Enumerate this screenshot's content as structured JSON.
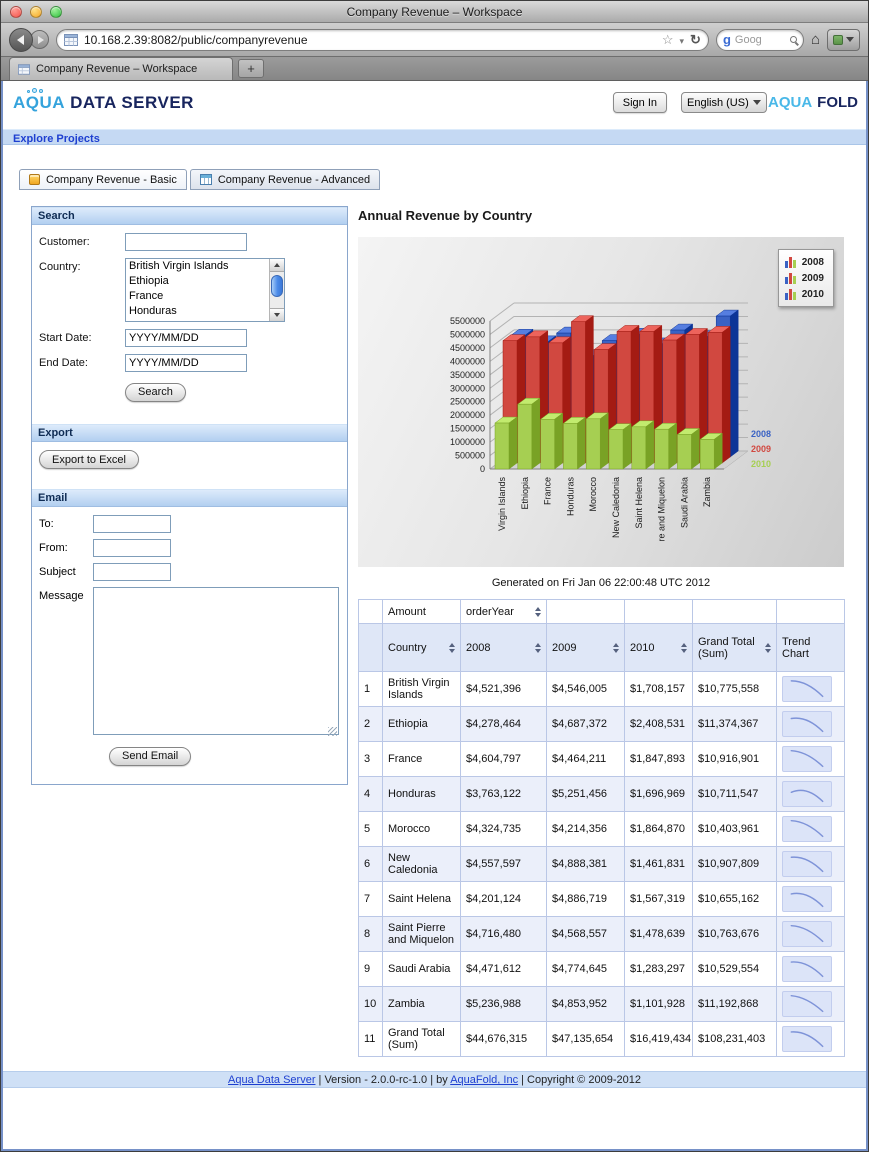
{
  "window": {
    "title": "Company Revenue – Workspace"
  },
  "browser": {
    "url": "10.168.2.39:8082/public/companyrevenue",
    "search_text": "Goog",
    "tab_title": "Company Revenue – Workspace",
    "new_tab_label": "+"
  },
  "header": {
    "logo_left": {
      "aqua": "AQUA",
      "rest": "DATA SERVER"
    },
    "sign_in_label": "Sign In",
    "language_value": "English (US)",
    "logo_right": {
      "aqua": "AQUA",
      "fold": "FOLD"
    }
  },
  "nav": {
    "explore_projects": "Explore Projects"
  },
  "app_tabs": [
    {
      "label": "Company Revenue - Basic"
    },
    {
      "label": "Company Revenue - Advanced"
    }
  ],
  "search_panel": {
    "title": "Search",
    "customer_label": "Customer:",
    "country_label": "Country:",
    "country_options": [
      "British Virgin Islands",
      "Ethiopia",
      "France",
      "Honduras"
    ],
    "start_date_label": "Start Date:",
    "end_date_label": "End Date:",
    "date_value": "YYYY/MM/DD",
    "search_button": "Search"
  },
  "export_panel": {
    "title": "Export",
    "button": "Export to Excel"
  },
  "email_panel": {
    "title": "Email",
    "to_label": "To:",
    "from_label": "From:",
    "subject_label": "Subject",
    "message_label": "Message",
    "send_button": "Send Email"
  },
  "report": {
    "title": "Annual Revenue by Country",
    "generated": "Generated on Fri Jan 06 22:00:48 UTC 2012"
  },
  "chart_data": {
    "type": "bar",
    "title": "Annual Revenue by Country",
    "categories": [
      "Virgin Islands",
      "Ethiopia",
      "France",
      "Honduras",
      "Morocco",
      "New Caledonia",
      "Saint Helena",
      "re and Miquelon",
      "Saudi Arabia",
      "Zambia"
    ],
    "series": [
      {
        "name": "2008",
        "color": "#3a62c4",
        "values": [
          4521396,
          4278464,
          4604797,
          3763122,
          4324735,
          4557597,
          4201124,
          4716480,
          4471612,
          5236988
        ]
      },
      {
        "name": "2009",
        "color": "#d14840",
        "values": [
          4546005,
          4687372,
          4464211,
          5251456,
          4214356,
          4888381,
          4886719,
          4568557,
          4774645,
          4853952
        ]
      },
      {
        "name": "2010",
        "color": "#a6cf52",
        "values": [
          1708157,
          2408531,
          1847893,
          1696969,
          1864870,
          1461831,
          1567319,
          1478639,
          1283297,
          1101928
        ]
      }
    ],
    "ylim": [
      0,
      5500000
    ],
    "ytick_step": 500000,
    "legend_position": "top-right",
    "grid": true
  },
  "table": {
    "amount_header": "Amount",
    "orderyear_header": "orderYear",
    "columns": {
      "country": "Country",
      "y2008": "2008",
      "y2009": "2009",
      "y2010": "2010",
      "total": "Grand Total (Sum)",
      "trend": "Trend Chart"
    },
    "rows": [
      {
        "n": "1",
        "country": "British Virgin Islands",
        "y2008": "$4,521,396",
        "y2009": "$4,546,005",
        "y2010": "$1,708,157",
        "total": "$10,775,558"
      },
      {
        "n": "2",
        "country": "Ethiopia",
        "y2008": "$4,278,464",
        "y2009": "$4,687,372",
        "y2010": "$2,408,531",
        "total": "$11,374,367"
      },
      {
        "n": "3",
        "country": "France",
        "y2008": "$4,604,797",
        "y2009": "$4,464,211",
        "y2010": "$1,847,893",
        "total": "$10,916,901"
      },
      {
        "n": "4",
        "country": "Honduras",
        "y2008": "$3,763,122",
        "y2009": "$5,251,456",
        "y2010": "$1,696,969",
        "total": "$10,711,547"
      },
      {
        "n": "5",
        "country": "Morocco",
        "y2008": "$4,324,735",
        "y2009": "$4,214,356",
        "y2010": "$1,864,870",
        "total": "$10,403,961"
      },
      {
        "n": "6",
        "country": "New Caledonia",
        "y2008": "$4,557,597",
        "y2009": "$4,888,381",
        "y2010": "$1,461,831",
        "total": "$10,907,809"
      },
      {
        "n": "7",
        "country": "Saint Helena",
        "y2008": "$4,201,124",
        "y2009": "$4,886,719",
        "y2010": "$1,567,319",
        "total": "$10,655,162"
      },
      {
        "n": "8",
        "country": "Saint Pierre and Miquelon",
        "y2008": "$4,716,480",
        "y2009": "$4,568,557",
        "y2010": "$1,478,639",
        "total": "$10,763,676"
      },
      {
        "n": "9",
        "country": "Saudi Arabia",
        "y2008": "$4,471,612",
        "y2009": "$4,774,645",
        "y2010": "$1,283,297",
        "total": "$10,529,554"
      },
      {
        "n": "10",
        "country": "Zambia",
        "y2008": "$5,236,988",
        "y2009": "$4,853,952",
        "y2010": "$1,101,928",
        "total": "$11,192,868"
      },
      {
        "n": "11",
        "country": "Grand Total (Sum)",
        "y2008": "$44,676,315",
        "y2009": "$47,135,654",
        "y2010": "$16,419,434",
        "total": "$108,231,403"
      }
    ]
  },
  "footer": {
    "link1": "Aqua Data Server",
    "sep1": " | Version - 2.0.0-rc-1.0 | by ",
    "link2": "AquaFold, Inc",
    "sep2": " | Copyright © 2009-2012"
  }
}
